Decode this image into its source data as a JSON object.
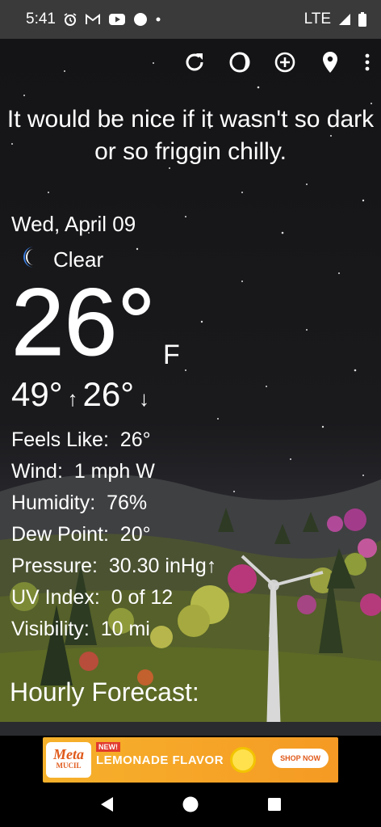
{
  "status_bar": {
    "time": "5:41",
    "network": "LTE",
    "left_icons": [
      "alarm-icon",
      "gmail-icon",
      "youtube-icon",
      "circle-icon",
      "dot-icon"
    ],
    "right_icons": [
      "signal-icon",
      "battery-icon"
    ]
  },
  "toolbar": {
    "icons": [
      "refresh-icon",
      "moon-phase-icon",
      "add-location-icon",
      "location-pin-icon",
      "more-vert-icon"
    ]
  },
  "headline": "It would be nice if it wasn't so dark or so friggin chilly.",
  "weather": {
    "date": "Wed, April 09",
    "condition": "Clear",
    "condition_icon": "moon-icon",
    "temperature": "26°",
    "unit": "F",
    "high": "49°",
    "low": "26°",
    "details": [
      {
        "label": "Feels Like:",
        "value": "26°"
      },
      {
        "label": "Wind:",
        "value": "1 mph W"
      },
      {
        "label": "Humidity:",
        "value": "76%"
      },
      {
        "label": "Dew Point:",
        "value": "20°"
      },
      {
        "label": "Pressure:",
        "value": "30.30 inHg↑"
      },
      {
        "label": "UV Index:",
        "value": "0 of 12"
      },
      {
        "label": "Visibility:",
        "value": "10 mi"
      }
    ]
  },
  "hourly": {
    "title": "Hourly Forecast:"
  },
  "ad": {
    "brand": "Meta",
    "brand_sub": "MUCIL",
    "badge": "NEW!",
    "title": "LEMONADE FLAVOR",
    "cta": "SHOP NOW"
  },
  "nav": {
    "icons": [
      "back-icon",
      "home-icon",
      "recents-icon"
    ]
  }
}
